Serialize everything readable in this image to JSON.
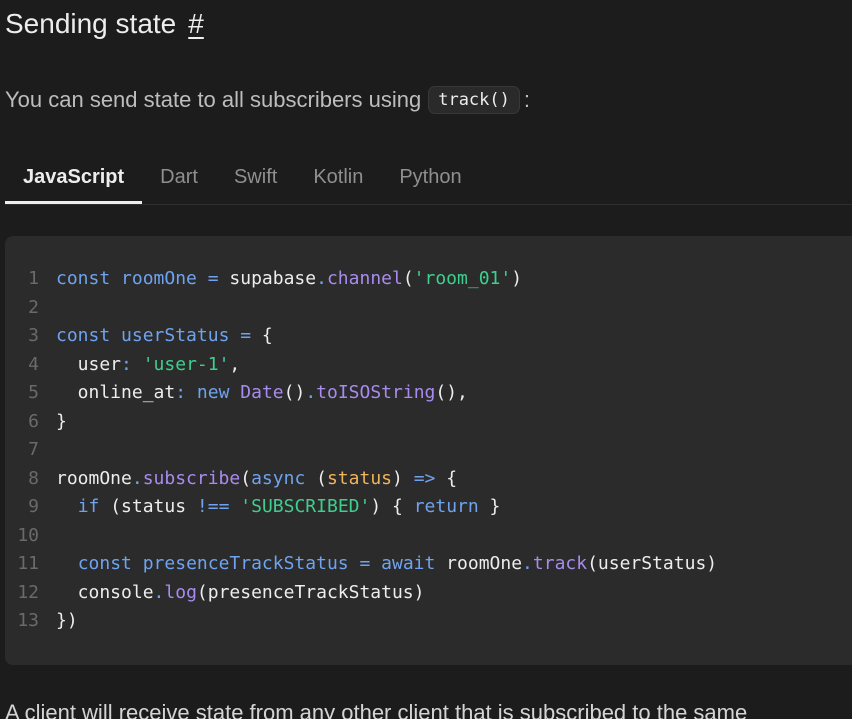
{
  "heading": {
    "title": "Sending state",
    "anchor": "#"
  },
  "intro": {
    "text": "You can send state to all subscribers using",
    "code": "track()",
    "suffix": ":"
  },
  "tabs": [
    "JavaScript",
    "Dart",
    "Swift",
    "Kotlin",
    "Python"
  ],
  "active_tab": "JavaScript",
  "colors": {
    "keyword": "#6fa3ef",
    "function": "#a98bf0",
    "string": "#3ecf8e",
    "param": "#f0b45c"
  },
  "code_lines": [
    [
      [
        "kw",
        "const"
      ],
      [
        "t",
        " "
      ],
      [
        "kw",
        "roomOne"
      ],
      [
        "t",
        " "
      ],
      [
        "op",
        "="
      ],
      [
        "t",
        " supabase"
      ],
      [
        "op",
        "."
      ],
      [
        "fn",
        "channel"
      ],
      [
        "t",
        "("
      ],
      [
        "str",
        "'room_01'"
      ],
      [
        "t",
        ")"
      ]
    ],
    [],
    [
      [
        "kw",
        "const"
      ],
      [
        "t",
        " "
      ],
      [
        "kw",
        "userStatus"
      ],
      [
        "t",
        " "
      ],
      [
        "op",
        "="
      ],
      [
        "t",
        " {"
      ]
    ],
    [
      [
        "t",
        "  user"
      ],
      [
        "op",
        ":"
      ],
      [
        "t",
        " "
      ],
      [
        "str",
        "'user-1'"
      ],
      [
        "t",
        ","
      ]
    ],
    [
      [
        "t",
        "  online_at"
      ],
      [
        "op",
        ":"
      ],
      [
        "t",
        " "
      ],
      [
        "kw",
        "new"
      ],
      [
        "t",
        " "
      ],
      [
        "fn",
        "Date"
      ],
      [
        "t",
        "()"
      ],
      [
        "op",
        "."
      ],
      [
        "fn",
        "toISOString"
      ],
      [
        "t",
        "(),"
      ]
    ],
    [
      [
        "t",
        "}"
      ]
    ],
    [],
    [
      [
        "t",
        "roomOne"
      ],
      [
        "op",
        "."
      ],
      [
        "fn",
        "subscribe"
      ],
      [
        "t",
        "("
      ],
      [
        "kw",
        "async"
      ],
      [
        "t",
        " ("
      ],
      [
        "param",
        "status"
      ],
      [
        "t",
        ") "
      ],
      [
        "op",
        "=>"
      ],
      [
        "t",
        " {"
      ]
    ],
    [
      [
        "t",
        "  "
      ],
      [
        "kw",
        "if"
      ],
      [
        "t",
        " (status "
      ],
      [
        "op",
        "!=="
      ],
      [
        "t",
        " "
      ],
      [
        "str",
        "'SUBSCRIBED'"
      ],
      [
        "t",
        ") { "
      ],
      [
        "kw",
        "return"
      ],
      [
        "t",
        " }"
      ]
    ],
    [],
    [
      [
        "t",
        "  "
      ],
      [
        "kw",
        "const"
      ],
      [
        "t",
        " "
      ],
      [
        "kw",
        "presenceTrackStatus"
      ],
      [
        "t",
        " "
      ],
      [
        "op",
        "="
      ],
      [
        "t",
        " "
      ],
      [
        "kw",
        "await"
      ],
      [
        "t",
        " roomOne"
      ],
      [
        "op",
        "."
      ],
      [
        "fn",
        "track"
      ],
      [
        "t",
        "(userStatus)"
      ]
    ],
    [
      [
        "t",
        "  console"
      ],
      [
        "op",
        "."
      ],
      [
        "fn",
        "log"
      ],
      [
        "t",
        "(presenceTrackStatus)"
      ]
    ],
    [
      [
        "t",
        "})"
      ]
    ]
  ],
  "outro": {
    "text": "A client will receive state from any other client that is subscribed to the same"
  }
}
